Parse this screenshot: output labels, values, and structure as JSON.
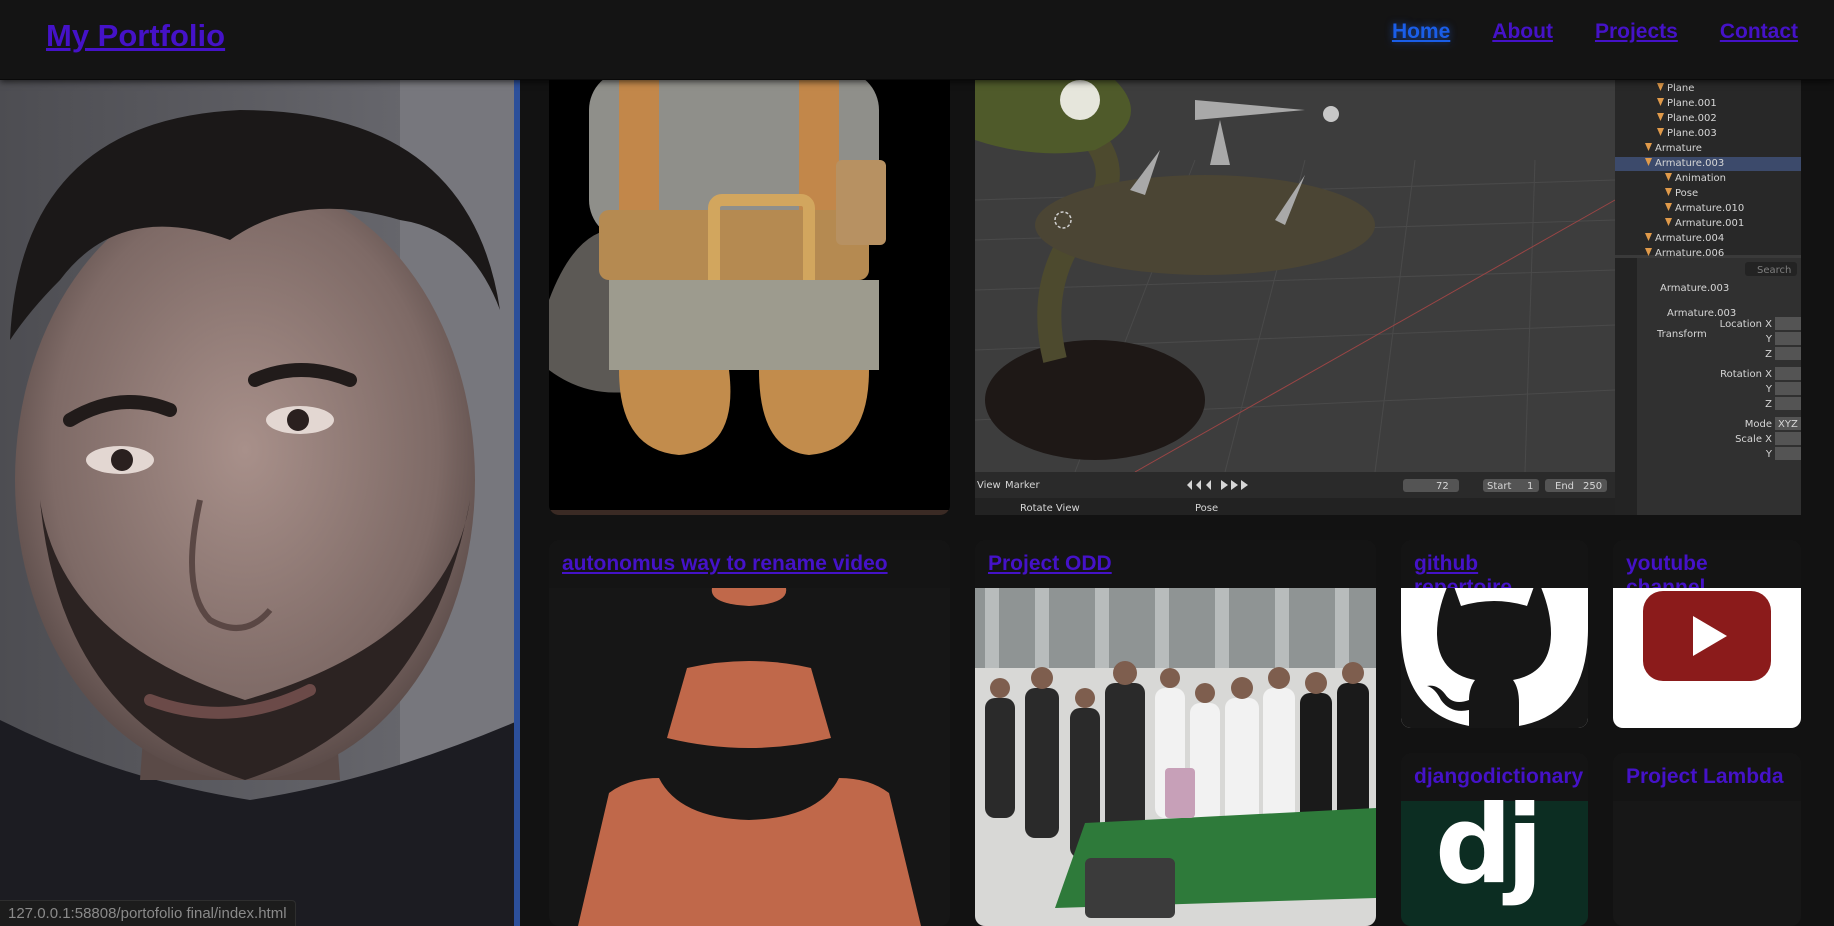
{
  "brand": "My Portfolio",
  "nav": {
    "home": "Home",
    "about": "About",
    "projects": "Projects",
    "contact": "Contact"
  },
  "status_url": "127.0.0.1:58808/portofolio final/index.html",
  "cards": {
    "vlc": {
      "title": "autonomus way to rename video"
    },
    "odd": {
      "title": "Project ODD"
    },
    "github": {
      "title": "github repertoire"
    },
    "youtube": {
      "title": "youtube channel"
    },
    "django": {
      "title": "djangodictionary",
      "logo_text": "dj"
    },
    "lambda": {
      "title": "Project Lambda"
    }
  },
  "blender": {
    "outliner": [
      "Plane",
      "Plane.001",
      "Plane.002",
      "Plane.003",
      "Armature",
      "Armature.003",
      "Animation",
      "Pose",
      "Armature.010",
      "Armature.001",
      "Armature.004",
      "Armature.006"
    ],
    "selected_object": "Armature.003",
    "data_name": "Armature.003",
    "panel": "Transform",
    "props": [
      "Location X",
      "Y",
      "Z",
      "Rotation X",
      "Y",
      "Z",
      "Mode",
      "Scale X",
      "Y"
    ],
    "mode_value": "XYZ",
    "search_placeholder": "Search",
    "timeline": {
      "view": "View",
      "marker": "Marker",
      "frame": "72",
      "start_label": "Start",
      "start": "1",
      "end_label": "End",
      "end": "250"
    },
    "footer": {
      "rotate": "Rotate View",
      "pose": "Pose"
    }
  },
  "colors": {
    "link": "#4512c8",
    "active_link": "#1a5ee8",
    "vlc_orange": "#c0684a",
    "youtube_red": "#8b1b1b",
    "django_green": "#0c2d22",
    "photo_border": "#2c4f9a"
  }
}
